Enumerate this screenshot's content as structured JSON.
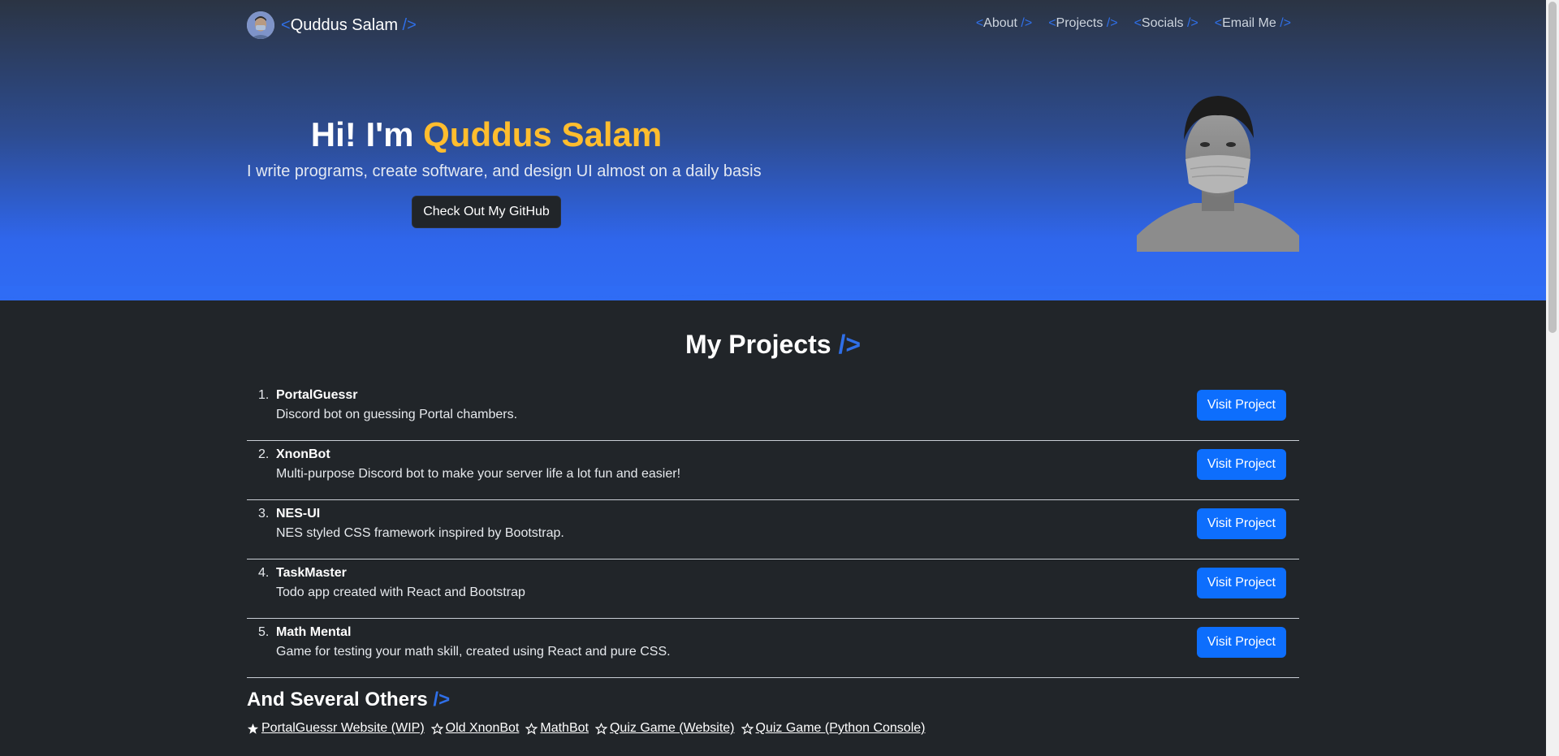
{
  "nav": {
    "brand_name": "Quddus Salam",
    "brand_open": "<",
    "brand_close": "/>",
    "links": [
      {
        "label": "About"
      },
      {
        "label": "Projects"
      },
      {
        "label": "Socials"
      },
      {
        "label": "Email Me"
      }
    ],
    "link_open": "<",
    "link_close": " />"
  },
  "hero": {
    "greeting": "Hi! I'm ",
    "name": "Quddus Salam",
    "subtitle": "I write programs, create software, and design UI almost on a daily basis",
    "button_label": "Check Out My GitHub"
  },
  "projects": {
    "title": "My Projects ",
    "title_suffix": "/>",
    "button_label": "Visit Project",
    "items": [
      {
        "num": "1.",
        "name": "PortalGuessr",
        "desc": "Discord bot on guessing Portal chambers."
      },
      {
        "num": "2.",
        "name": "XnonBot",
        "desc": "Multi-purpose Discord bot to make your server life a lot fun and easier!"
      },
      {
        "num": "3.",
        "name": "NES-UI",
        "desc": "NES styled CSS framework inspired by Bootstrap."
      },
      {
        "num": "4.",
        "name": "TaskMaster",
        "desc": "Todo app created with React and Bootstrap"
      },
      {
        "num": "5.",
        "name": "Math Mental",
        "desc": "Game for testing your math skill, created using React and pure CSS."
      }
    ]
  },
  "others": {
    "title": "And Several Others ",
    "title_suffix": "/>",
    "links": [
      {
        "label": "PortalGuessr Website (WIP)",
        "icon": "star-filled-icon"
      },
      {
        "label": "Old XnonBot",
        "icon": "star-outline-icon"
      },
      {
        "label": "MathBot",
        "icon": "star-outline-icon"
      },
      {
        "label": "Quiz Game (Website)",
        "icon": "star-outline-icon"
      },
      {
        "label": "Quiz Game (Python Console)",
        "icon": "star-outline-icon"
      }
    ]
  },
  "colors": {
    "accent": "#2f6fe8",
    "name_highlight": "#ffbd2e",
    "background": "#212529",
    "button_primary": "#0d6efd"
  }
}
